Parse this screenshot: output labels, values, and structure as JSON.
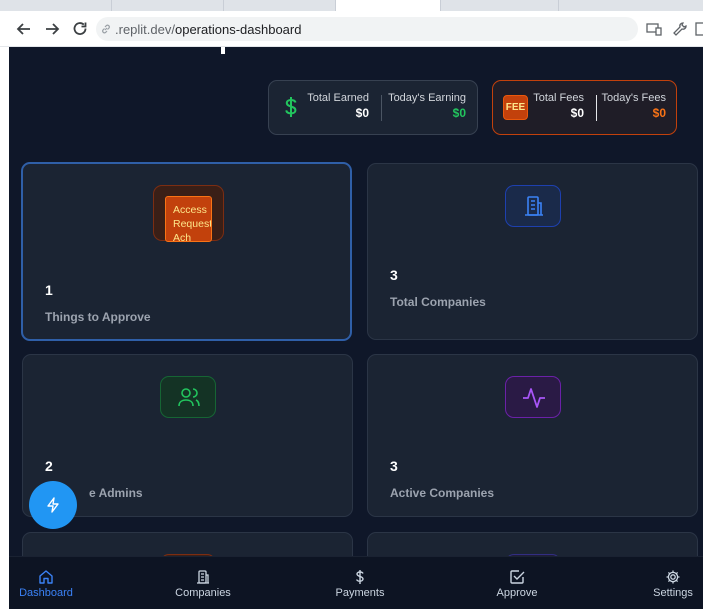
{
  "browser": {
    "url_dim": ".replit.dev/",
    "url_path": "operations-dashboard"
  },
  "stats": {
    "earnings": {
      "total_label": "Total Earned",
      "total_value": "$0",
      "today_label": "Today's Earning",
      "today_value": "$0",
      "accent": "#22c55e"
    },
    "fees": {
      "badge": "FEE",
      "total_label": "Total Fees",
      "total_value": "$0",
      "today_label": "Today's Fees",
      "today_value": "$0",
      "accent": "#f97316"
    }
  },
  "cards": [
    {
      "count": "1",
      "label": "Things to Approve",
      "icon_text": "Access Request Ach",
      "icon": "access-request-badge"
    },
    {
      "count": "3",
      "label": "Total Companies",
      "icon": "building-icon",
      "color": "#3b82f6"
    },
    {
      "count": "2",
      "label": "e Admins",
      "icon": "users-icon",
      "color": "#22c55e"
    },
    {
      "count": "3",
      "label": "Active Companies",
      "icon": "activity-icon",
      "color": "#a855f7"
    }
  ],
  "bottom_nav": [
    {
      "label": "Dashboard",
      "icon": "home-icon",
      "active": true
    },
    {
      "label": "Companies",
      "icon": "building-icon"
    },
    {
      "label": "Payments",
      "icon": "dollar-icon"
    },
    {
      "label": "Approve",
      "icon": "check-square-icon"
    },
    {
      "label": "Settings",
      "icon": "gear-icon"
    }
  ]
}
